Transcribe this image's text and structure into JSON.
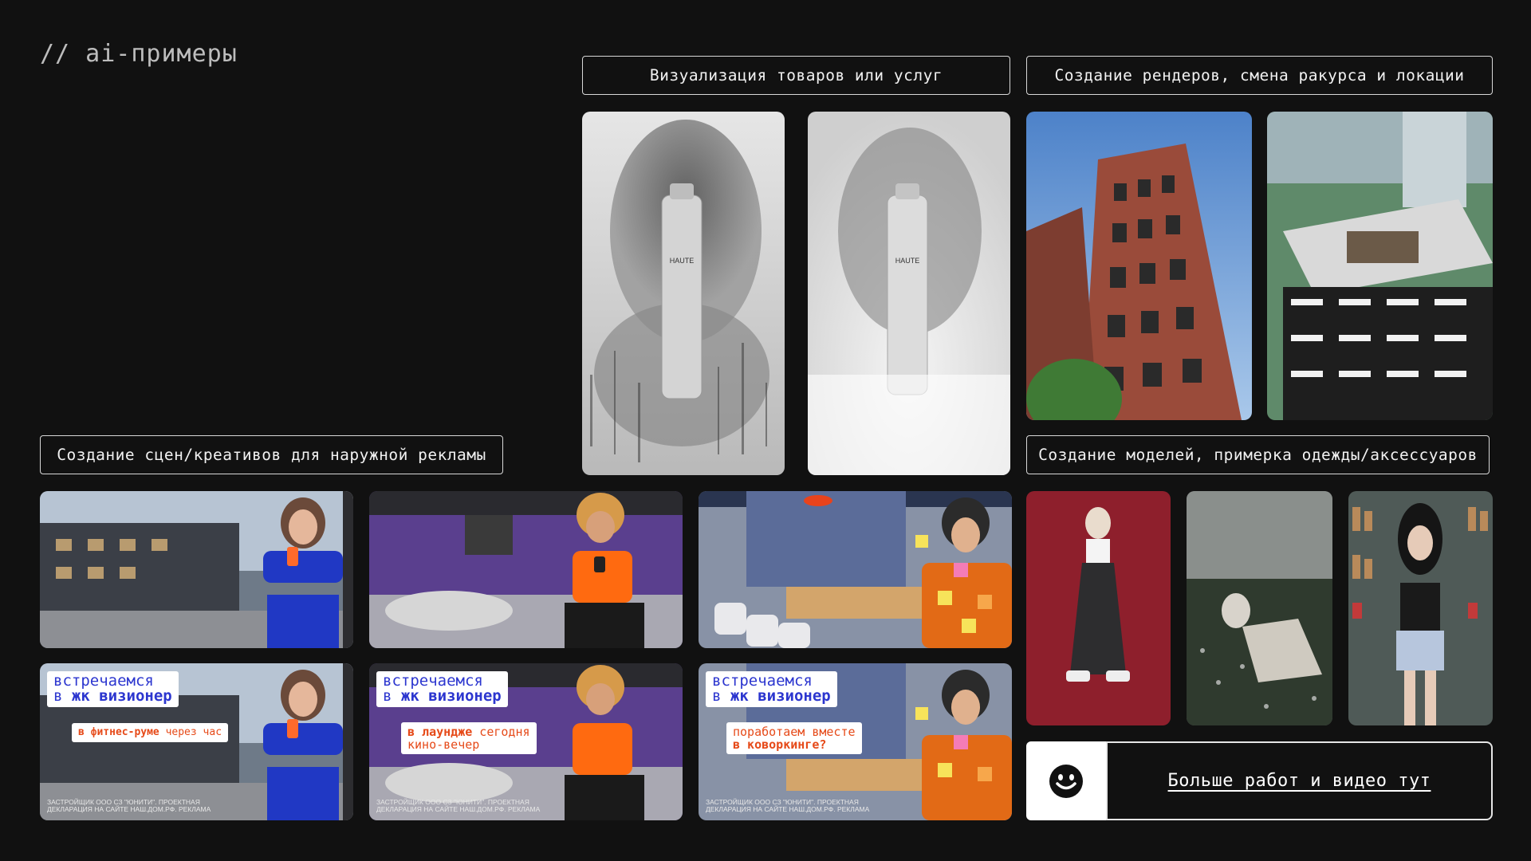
{
  "header": {
    "title": "// ai-примеры"
  },
  "sections": {
    "visualization": "Визуализация товаров или услуг",
    "renders": "Создание рендеров, смена ракурса и локации",
    "outdoor": "Создание сцен/креативов для наружной рекламы",
    "models": "Создание моделей, примерка одежды/аксессуаров"
  },
  "ads": [
    {
      "title_line1": "встречаемся",
      "title_prefix": "в",
      "title_bold": "жк визионер",
      "sub_bold": "в фитнес-руме",
      "sub_rest": " через час",
      "legal": "ЗАСТРОЙЩИК ООО СЗ \"ЮНИТИ\". ПРОЕКТНАЯ ДЕКЛАРАЦИЯ НА САЙТЕ НАШ.ДОМ.РФ. РЕКЛАМА"
    },
    {
      "title_line1": "встречаемся",
      "title_prefix": "в",
      "title_bold": "жк визионер",
      "sub_bold": "в лаундже",
      "sub_rest": " сегодня",
      "sub_line2": "кино-вечер",
      "legal": "ЗАСТРОЙЩИК ООО СЗ \"ЮНИТИ\". ПРОЕКТНАЯ ДЕКЛАРАЦИЯ НА САЙТЕ НАШ.ДОМ.РФ. РЕКЛАМА"
    },
    {
      "title_line1": "встречаемся",
      "title_prefix": "в",
      "title_bold": "жк визионер",
      "sub_line1": "поработаем вместе",
      "sub_bold2": "в коворкинге?",
      "legal": "ЗАСТРОЙЩИК ООО СЗ \"ЮНИТИ\". ПРОЕКТНАЯ ДЕКЛАРАЦИЯ НА САЙТЕ НАШ.ДОМ.РФ. РЕКЛАМА"
    }
  ],
  "product": {
    "bottle_text": "HAUTE"
  },
  "more": {
    "link": "Больше работ и видео тут",
    "icon": "smiley-icon"
  },
  "colors": {
    "background": "#111111",
    "ad_blue": "#2c36cf",
    "ad_orange": "#e64a19"
  }
}
